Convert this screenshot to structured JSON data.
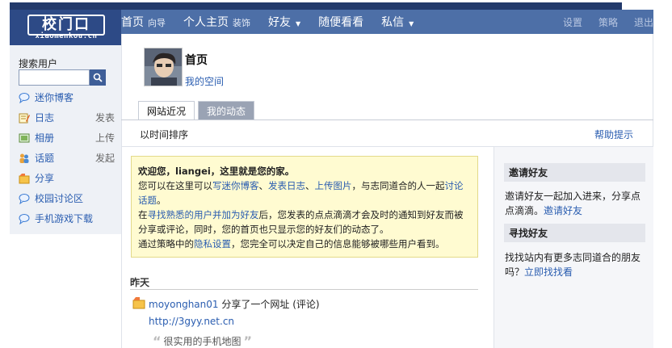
{
  "logo": {
    "main": "校门口",
    "sub": "xiaomenkou.cn"
  },
  "nav": {
    "items": [
      {
        "label": "首页",
        "sub": "向导"
      },
      {
        "label": "个人主页",
        "sub": "装饰"
      },
      {
        "label": "好友",
        "sub": ""
      },
      {
        "label": "随便看看",
        "sub": ""
      },
      {
        "label": "私信",
        "sub": ""
      }
    ],
    "right": [
      "设置",
      "策略",
      "退出"
    ]
  },
  "sidebar": {
    "search_label": "搜索用户",
    "search_placeholder": "",
    "items": [
      {
        "label": "迷你博客",
        "action": "",
        "icon": "mini-blog-icon"
      },
      {
        "label": "日志",
        "action": "发表",
        "icon": "blog-icon"
      },
      {
        "label": "相册",
        "action": "上传",
        "icon": "album-icon"
      },
      {
        "label": "话题",
        "action": "发起",
        "icon": "topic-icon"
      },
      {
        "label": "分享",
        "action": "",
        "icon": "share-icon"
      },
      {
        "label": "校园讨论区",
        "action": "",
        "icon": "forum-icon"
      },
      {
        "label": "手机游戏下载",
        "action": "",
        "icon": "mobile-game-icon"
      }
    ]
  },
  "profile": {
    "title": "首页",
    "my_space": "我的空间"
  },
  "tabs": [
    "网站近况",
    "我的动态"
  ],
  "sort_label": "以时间排序",
  "help_label": "帮助提示",
  "welcome": {
    "line1": "欢迎您，liangei，这里就是您的家。",
    "line2_a": "您可以在这里可以",
    "link_mini": "写迷你博客",
    "sep1": "、",
    "link_blog": "发表日志",
    "sep2": "、",
    "link_photo": "上传图片",
    "line2_b": "，与志同道合的人一起",
    "link_topic": "讨论话题",
    "line2_c": "。",
    "link_find": "寻找熟悉的用户并加为好友",
    "line3_pre": "在",
    "line3_b": "后，您发表的点点滴滴才会及时的通知到好友而被分享或评论，同时，您的首页也只显示您的好友们的动态了。",
    "line4_a": "通过策略中的",
    "link_privacy": "隐私设置",
    "line4_b": "，您完全可以决定自己的信息能够被哪些用户看到。"
  },
  "right": {
    "invite_title": "邀请好友",
    "invite_text": "邀请好友一起加入进来，分享点点滴滴。",
    "invite_link": "邀请好友",
    "find_title": "寻找好友",
    "find_text": "找找站内有更多志同道合的朋友吗？",
    "find_link": "立即找找看"
  },
  "feed": {
    "day_label": "昨天",
    "user": "moyonghan01",
    "action": "分享了一个网址",
    "comment": "(评论)",
    "url": "http://3gyy.net.cn",
    "quote": "很实用的手机地图"
  }
}
